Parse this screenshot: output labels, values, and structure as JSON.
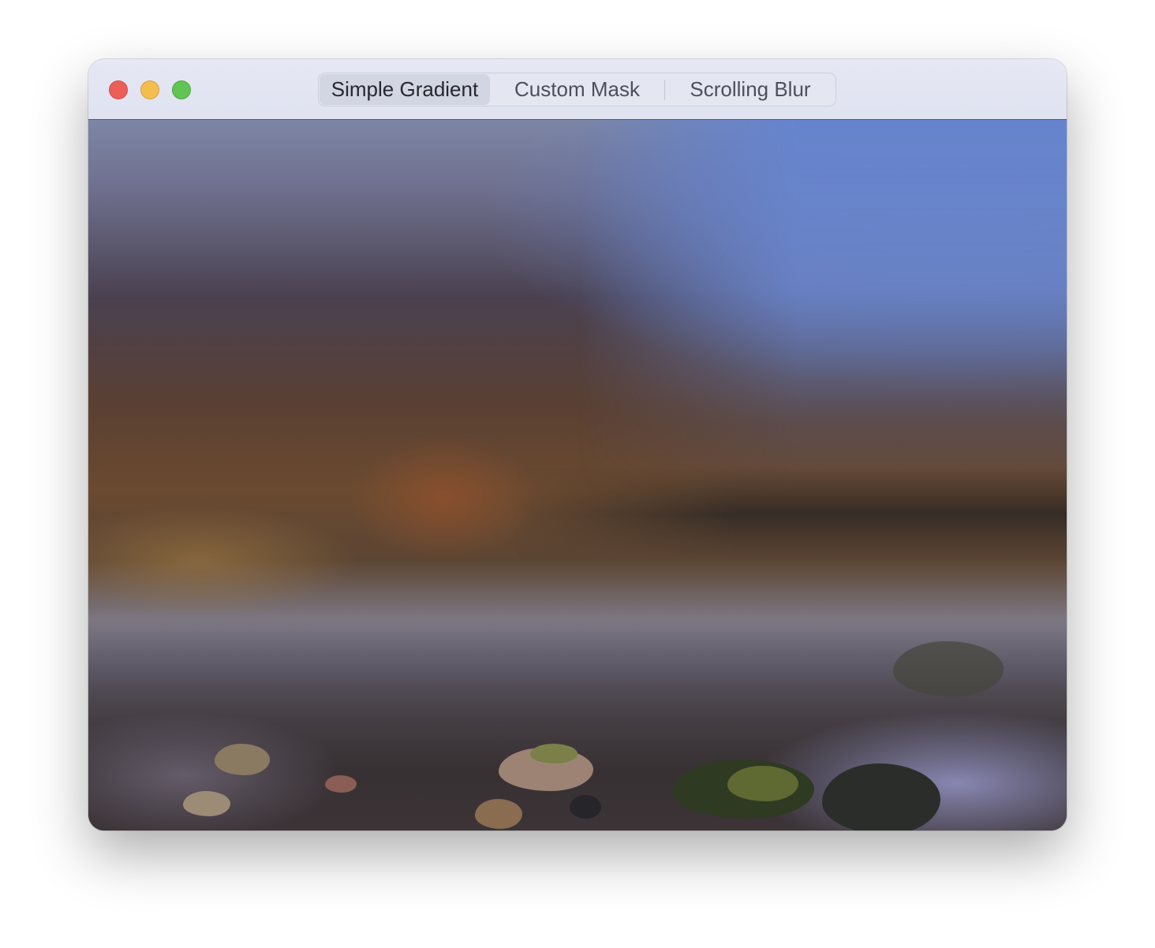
{
  "window": {
    "controls": {
      "close": "close-button",
      "minimize": "minimize-button",
      "zoom": "zoom-button"
    }
  },
  "toolbar": {
    "segments": [
      {
        "label": "Simple Gradient",
        "selected": true
      },
      {
        "label": "Custom Mask",
        "selected": false
      },
      {
        "label": "Scrolling Blur",
        "selected": false
      }
    ]
  },
  "colors": {
    "close": "#ec5f59",
    "minimize": "#f4bd4f",
    "zoom": "#61c454",
    "titlebar": "#e2e5f2"
  }
}
